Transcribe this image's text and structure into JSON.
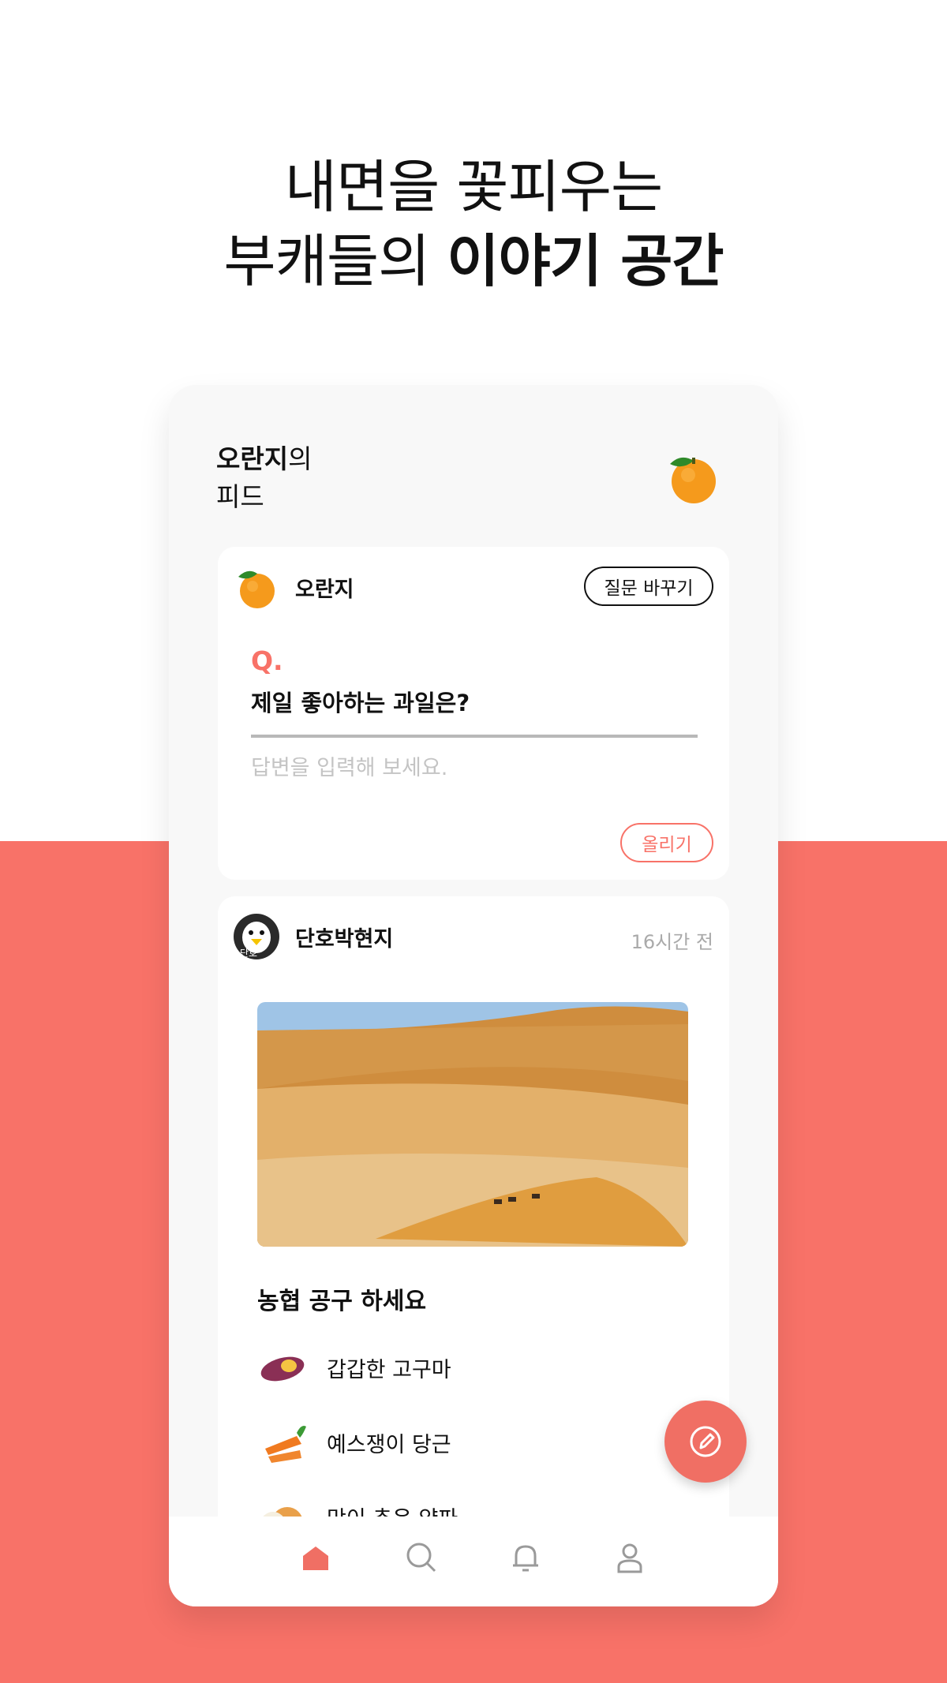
{
  "headline": {
    "line1": "내면을 꽃피우는",
    "line2_regular": "부캐들의 ",
    "line2_bold": "이야기 공간"
  },
  "feed": {
    "owner_name": "오란지",
    "owner_suffix": "의",
    "title_line2": "피드",
    "avatar_icon": "orange-icon"
  },
  "question_card": {
    "username": "오란지",
    "change_button": "질문 바꾸기",
    "q_label": "Q.",
    "question": "제일 좋아하는 과일은?",
    "answer_placeholder": "답변을 입력해 보세요.",
    "post_button": "올리기"
  },
  "post_card": {
    "username": "단호박현지",
    "avatar_caption": "단호",
    "time": "16시간 전",
    "image_alt": "desert-dunes-image",
    "title": "농협 공구 하세요",
    "items": [
      {
        "icon": "sweet-potato-icon",
        "label": "갑갑한 고구마"
      },
      {
        "icon": "carrot-icon",
        "label": "예스쟁이 당근"
      },
      {
        "icon": "onion-icon",
        "label": "맛이 추운 양파"
      }
    ]
  },
  "fab": {
    "icon": "write-icon"
  },
  "bottom_nav": [
    {
      "name": "home",
      "icon": "home-icon",
      "active": true
    },
    {
      "name": "search",
      "icon": "search-icon",
      "active": false
    },
    {
      "name": "notifications",
      "icon": "bell-icon",
      "active": false
    },
    {
      "name": "profile",
      "icon": "person-icon",
      "active": false
    }
  ],
  "colors": {
    "accent": "#f87268",
    "text": "#111111",
    "muted": "#aaaaaa",
    "card_bg": "#ffffff",
    "screen_bg": "#f8f8f8"
  }
}
